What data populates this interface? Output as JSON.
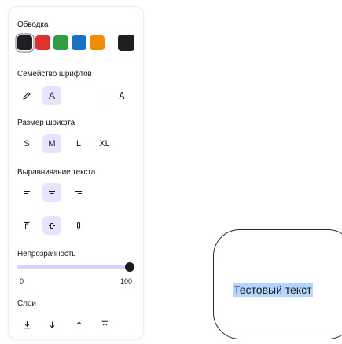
{
  "stroke": {
    "label": "Обводка",
    "colors": [
      {
        "name": "black",
        "hex": "#1e1e23",
        "selected": true
      },
      {
        "name": "red",
        "hex": "#e03131"
      },
      {
        "name": "green",
        "hex": "#2f9e44"
      },
      {
        "name": "blue",
        "hex": "#1971c2"
      },
      {
        "name": "orange",
        "hex": "#f08c00"
      },
      {
        "name": "current",
        "hex": "#1e1e23"
      }
    ]
  },
  "font_family": {
    "label": "Семейство шрифтов",
    "options": [
      {
        "icon": "pencil-icon",
        "active": false
      },
      {
        "icon": "letter-a-normal-icon",
        "glyph": "A",
        "active": true
      },
      {
        "icon": "letter-a-code-icon",
        "glyph": "A",
        "active": false
      }
    ]
  },
  "font_size": {
    "label": "Размер шрифта",
    "options": [
      {
        "label": "S",
        "active": false
      },
      {
        "label": "M",
        "active": true
      },
      {
        "label": "L",
        "active": false
      },
      {
        "label": "XL",
        "active": false
      }
    ]
  },
  "text_align": {
    "label": "Выравнивание текста",
    "horizontal": [
      {
        "icon": "align-left-icon",
        "active": false
      },
      {
        "icon": "align-center-icon",
        "active": true
      },
      {
        "icon": "align-right-icon",
        "active": false
      }
    ],
    "vertical": [
      {
        "icon": "align-top-icon",
        "active": false
      },
      {
        "icon": "align-middle-icon",
        "active": true
      },
      {
        "icon": "align-bottom-icon",
        "active": false
      }
    ]
  },
  "opacity": {
    "label": "Непрозрачность",
    "min": "0",
    "max": "100",
    "value": 100
  },
  "layers": {
    "label": "Слои",
    "actions": [
      {
        "icon": "send-to-back-icon"
      },
      {
        "icon": "send-backward-icon"
      },
      {
        "icon": "bring-forward-icon"
      },
      {
        "icon": "bring-to-front-icon"
      }
    ]
  },
  "canvas": {
    "text": "Тестовый текст",
    "selection_color": "#b4d5fe",
    "accent": "#e4e5fd"
  }
}
